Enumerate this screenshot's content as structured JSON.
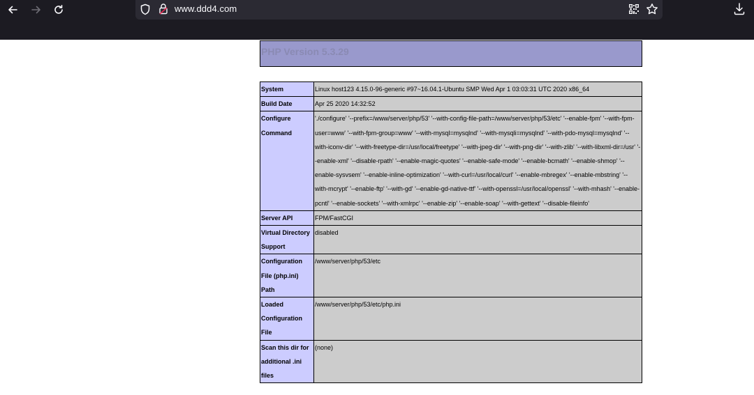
{
  "browser": {
    "url_host": "www.ddd4.com",
    "icons": [
      "back-icon",
      "forward-icon",
      "reload-icon",
      "shield-icon",
      "lock-warning-icon",
      "qr-code-icon",
      "star-icon",
      "download-icon"
    ]
  },
  "php": {
    "version_title": "PHP Version 5.3.29",
    "header_bg": "#9999cc",
    "label_bg": "#ccccff",
    "value_bg": "#cccccc"
  },
  "table": {
    "rows": [
      {
        "label": "System",
        "value": "Linux host123 4.15.0-96-generic #97~16.04.1-Ubuntu SMP Wed Apr 1 03:03:31 UTC 2020 x86_64"
      },
      {
        "label": "Build Date",
        "value": "Apr 25 2020 14:32:52"
      },
      {
        "label": "Configure Command",
        "value": "'./configure' '--prefix=/www/server/php/53' '--with-config-file-path=/www/server/php/53/etc' '--enable-fpm' '--with-fpm-user=www' '--with-fpm-group=www' '--with-mysql=mysqlnd' '--with-mysqli=mysqlnd' '--with-pdo-mysql=mysqlnd' '--with-iconv-dir' '--with-freetype-dir=/usr/local/freetype' '--with-jpeg-dir' '--with-png-dir' '--with-zlib' '--with-libxml-dir=/usr' '--enable-xml' '--disable-rpath' '--enable-magic-quotes' '--enable-safe-mode' '--enable-bcmath' '--enable-shmop' '--enable-sysvsem' '--enable-inline-optimization' '--with-curl=/usr/local/curl' '--enable-mbregex' '--enable-mbstring' '--with-mcrypt' '--enable-ftp' '--with-gd' '--enable-gd-native-ttf' '--with-openssl=/usr/local/openssl' '--with-mhash' '--enable-pcntl' '--enable-sockets' '--with-xmlrpc' '--enable-zip' '--enable-soap' '--with-gettext' '--disable-fileinfo'"
      },
      {
        "label": "Server API",
        "value": "FPM/FastCGI"
      },
      {
        "label": "Virtual Directory Support",
        "value": "disabled"
      },
      {
        "label": "Configuration File (php.ini) Path",
        "value": "/www/server/php/53/etc"
      },
      {
        "label": "Loaded Configuration File",
        "value": "/www/server/php/53/etc/php.ini"
      },
      {
        "label": "Scan this dir for additional .ini files",
        "value": "(none)"
      }
    ]
  }
}
